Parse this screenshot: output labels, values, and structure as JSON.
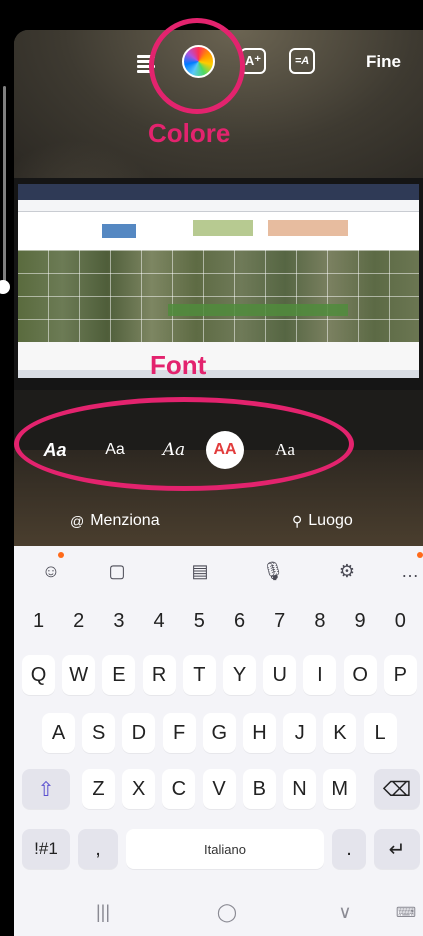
{
  "toolbar": {
    "effect_glyph": "A⁺",
    "align_glyph": "=A",
    "done_label": "Fine"
  },
  "annotations": {
    "color_label": "Colore",
    "font_label": "Font",
    "accent_color": "#e3236e"
  },
  "fonts": [
    {
      "label": "Aa"
    },
    {
      "label": "Aa"
    },
    {
      "label": "Aa"
    },
    {
      "label": "AA",
      "selected": true
    },
    {
      "label": "Aa"
    }
  ],
  "actions": {
    "mention_label": "Menziona",
    "mention_icon": "@",
    "location_label": "Luogo",
    "location_icon": "⚲"
  },
  "keyboard": {
    "toolbar_icons": [
      "emoji-icon",
      "clipboard-icon",
      "keyboard-mode-icon",
      "microphone-icon",
      "settings-icon",
      "more-icon"
    ],
    "number_row": [
      "1",
      "2",
      "3",
      "4",
      "5",
      "6",
      "7",
      "8",
      "9",
      "0"
    ],
    "row1": [
      "Q",
      "W",
      "E",
      "R",
      "T",
      "Y",
      "U",
      "I",
      "O",
      "P"
    ],
    "row2": [
      "A",
      "S",
      "D",
      "F",
      "G",
      "H",
      "J",
      "K",
      "L"
    ],
    "row3": [
      "Z",
      "X",
      "C",
      "V",
      "B",
      "N",
      "M"
    ],
    "symbols_label": "!#1",
    "comma_label": ",",
    "space_label": "Italiano",
    "period_label": ".",
    "shift_glyph": "⇧",
    "backspace_glyph": "⌫",
    "enter_glyph": "↵"
  },
  "navbar": {
    "recents_glyph": "|||",
    "home_glyph": "◯",
    "back_glyph": "∨",
    "keyboard_glyph": "⌨"
  }
}
